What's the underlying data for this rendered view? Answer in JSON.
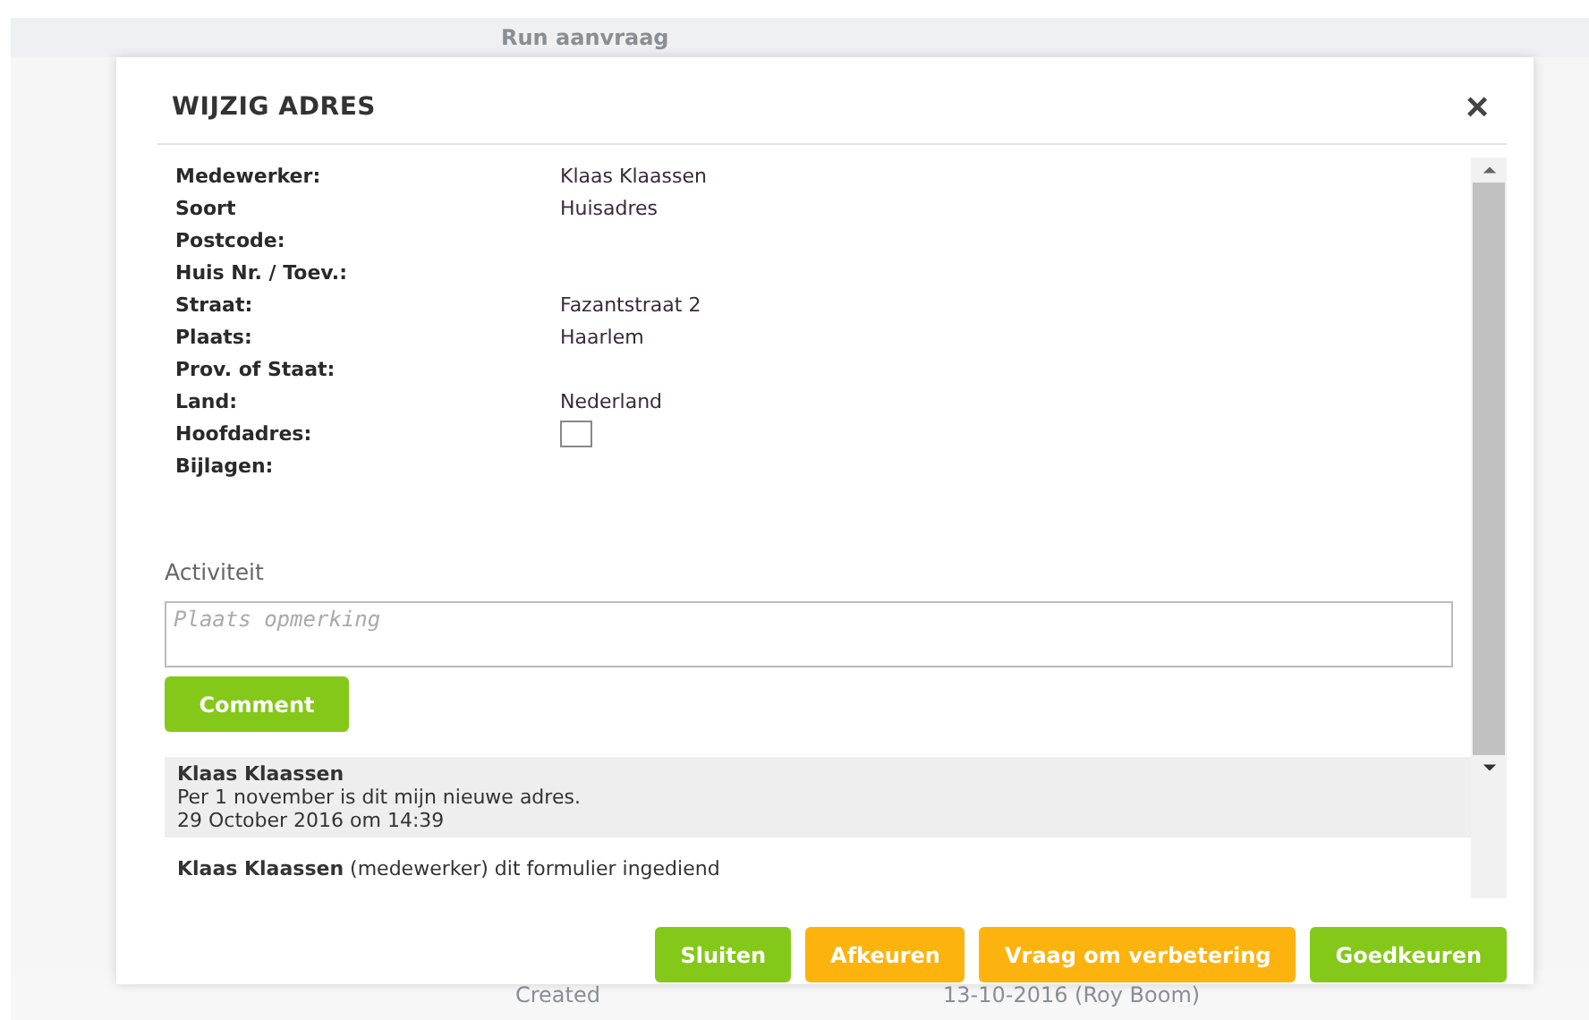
{
  "background": {
    "header": "Run aanvraag",
    "footer_label": "Created",
    "footer_value": "13-10-2016 (Roy Boom)"
  },
  "dialog": {
    "title": "WIJZIG ADRES",
    "close": "×",
    "fields": [
      {
        "label": "Medewerker:",
        "value": "Klaas Klaassen",
        "kind": "text"
      },
      {
        "label": "Soort",
        "value": "Huisadres",
        "kind": "text"
      },
      {
        "label": "Postcode:",
        "kind": "text"
      },
      {
        "label": "Huis Nr. / Toev.:",
        "kind": "text"
      },
      {
        "label": "Straat:",
        "value": "Fazantstraat 2",
        "kind": "text"
      },
      {
        "label": "Plaats:",
        "value": "Haarlem",
        "kind": "text"
      },
      {
        "label": "Prov. of Staat:",
        "kind": "text"
      },
      {
        "label": "Land:",
        "value": "Nederland",
        "kind": "text"
      },
      {
        "label": "Hoofdadres:",
        "kind": "checkbox",
        "checked": false
      },
      {
        "label": "Bijlagen:",
        "kind": "text"
      }
    ],
    "activity_heading": "Activiteit",
    "comment_field": {
      "placeholder": "Plaats opmerking"
    },
    "comment_button": "Comment",
    "activity": [
      {
        "author": "Klaas Klaassen",
        "text": "Per 1 november is dit mijn nieuwe adres.",
        "date": "29 October 2016 om 14:39",
        "highlighted": true
      },
      {
        "text": "**Klaas Klaassen** (medewerker) dit formulier ingediend",
        "highlighted": false
      }
    ],
    "buttons": [
      {
        "label": "Sluiten",
        "color": "#84c91a"
      },
      {
        "label": "Afkeuren",
        "color": "#fdb30e"
      },
      {
        "label": "Vraag om verbetering",
        "color": "#fdb30e"
      },
      {
        "label": "Goedkeuren",
        "color": "#84c91a"
      }
    ]
  }
}
